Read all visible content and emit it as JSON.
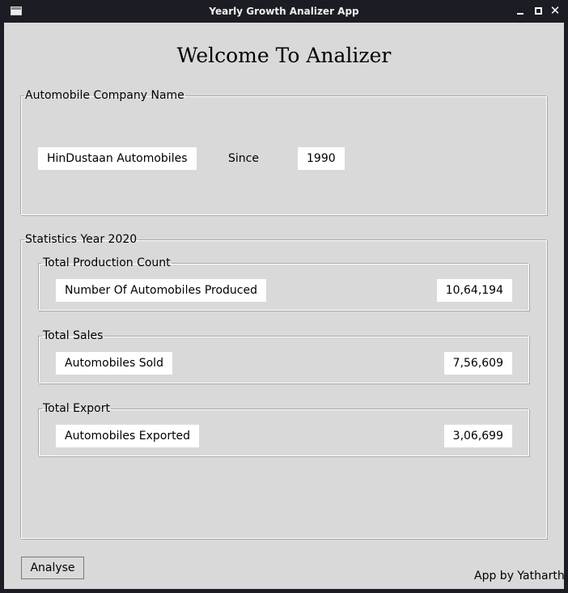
{
  "window": {
    "title": "Yearly Growth Analizer App"
  },
  "heading": "Welcome To Analizer",
  "company_section": {
    "legend": "Automobile Company Name",
    "company_name": "HinDustaan Automobiles",
    "since_label": "Since",
    "since_year": "1990"
  },
  "statistics_section": {
    "legend": "Statistics Year 2020",
    "production": {
      "legend": "Total Production Count",
      "label": "Number Of Automobiles Produced",
      "value": "10,64,194"
    },
    "sales": {
      "legend": "Total Sales",
      "label": "Automobiles Sold",
      "value": "7,56,609"
    },
    "export": {
      "legend": "Total Export",
      "label": "Automobiles Exported",
      "value": "3,06,699"
    }
  },
  "footer": {
    "analyse_label": "Analyse",
    "credit": "App by Yatharth"
  },
  "icons": {
    "app": "app-window-icon",
    "minimize": "minimize-icon",
    "maximize": "maximize-icon",
    "close": "close-icon"
  }
}
